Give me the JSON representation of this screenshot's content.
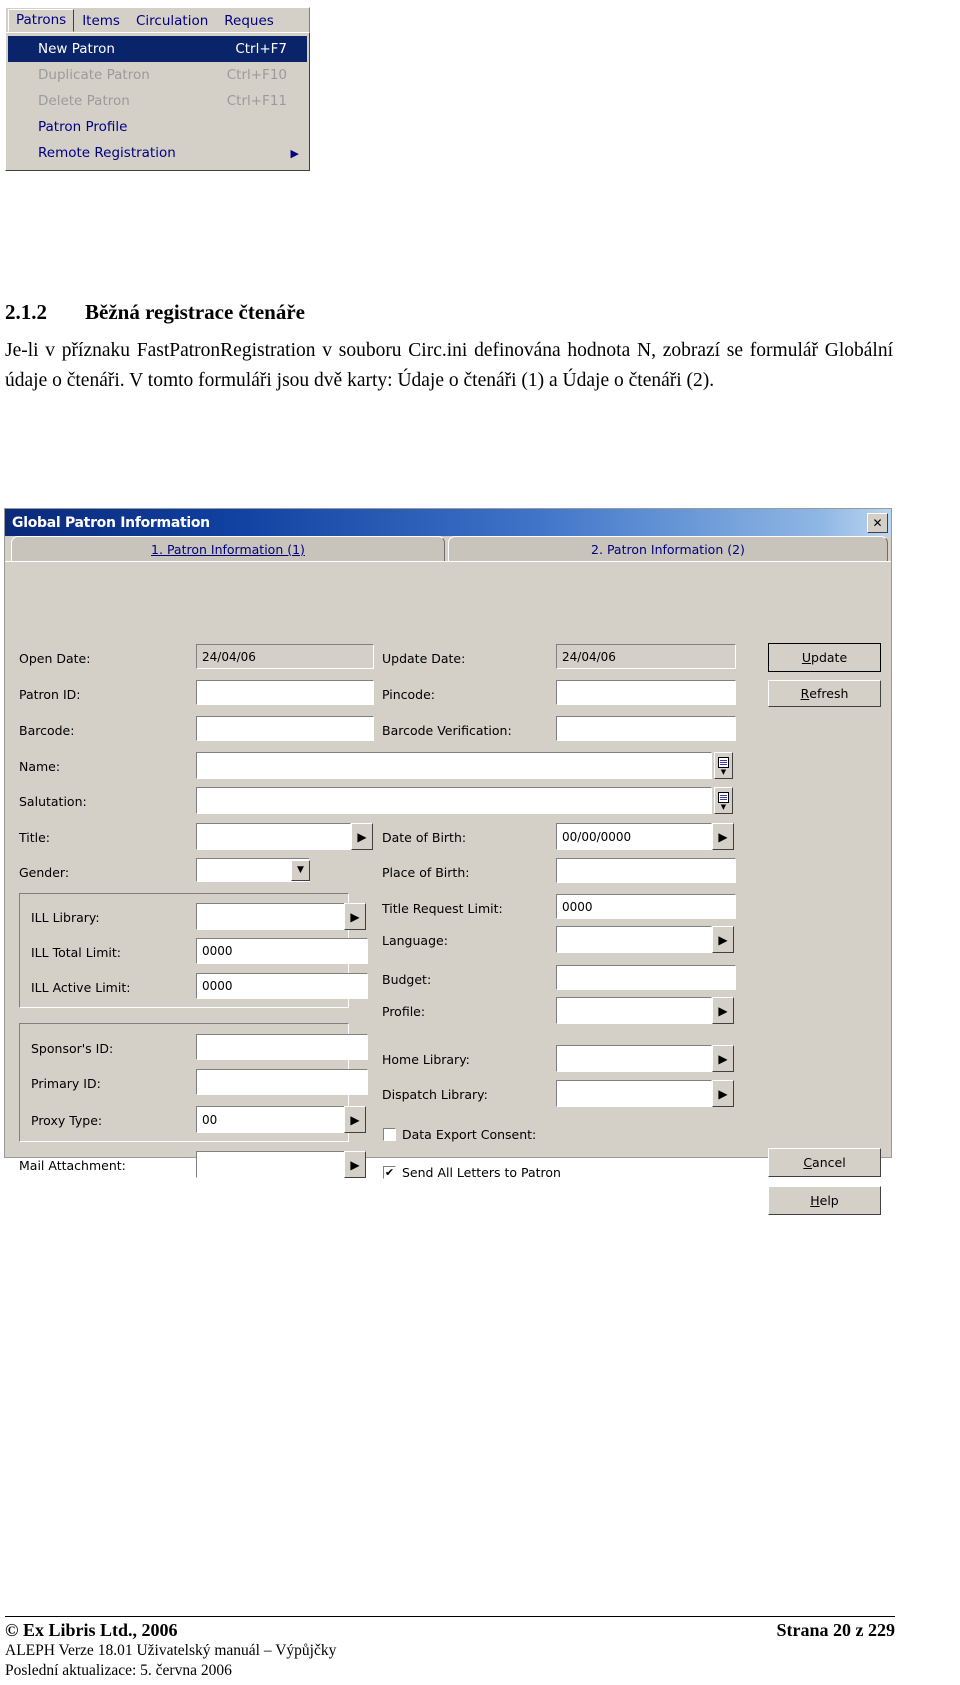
{
  "menu": {
    "menubar": [
      {
        "label": "Patrons",
        "open": true
      },
      {
        "label": "Items",
        "open": false
      },
      {
        "label": "Circulation",
        "open": false
      },
      {
        "label": "Reques",
        "open": false
      }
    ],
    "items": [
      {
        "label": "New Patron",
        "accel": "Ctrl+F7",
        "state": "highlight",
        "submenu": false
      },
      {
        "label": "Duplicate Patron",
        "accel": "Ctrl+F10",
        "state": "disabled",
        "submenu": false
      },
      {
        "label": "Delete Patron",
        "accel": "Ctrl+F11",
        "state": "disabled",
        "submenu": false
      },
      {
        "label": "Patron Profile",
        "accel": "",
        "state": "normal",
        "submenu": false
      },
      {
        "label": "Remote Registration",
        "accel": "",
        "state": "normal",
        "submenu": true
      }
    ]
  },
  "document": {
    "heading_number": "2.1.2",
    "heading_title": "Běžná registrace čtenáře",
    "paragraph": "Je-li v příznaku FastPatronRegistration v souboru Circ.ini definována hodnota N, zobrazí se formulář Globální údaje o čtenáři. V tomto formuláři jsou dvě karty: Údaje o čtenáři (1) a Údaje o čtenáři (2)."
  },
  "dialog": {
    "title": "Global Patron Information",
    "close_glyph": "✕",
    "tabs": [
      {
        "label": "1. Patron Information (1)",
        "active": true
      },
      {
        "label": "2. Patron Information (2)",
        "active": false
      }
    ],
    "fields": {
      "open_date": {
        "label": "Open Date:",
        "value": "24/04/06",
        "readonly": true
      },
      "update_date": {
        "label": "Update Date:",
        "value": "24/04/06",
        "readonly": true
      },
      "patron_id": {
        "label": "Patron ID:",
        "value": ""
      },
      "pincode": {
        "label": "Pincode:",
        "value": ""
      },
      "barcode": {
        "label": "Barcode:",
        "value": ""
      },
      "barcode_verification": {
        "label": "Barcode Verification:",
        "value": ""
      },
      "name": {
        "label": "Name:",
        "value": ""
      },
      "salutation": {
        "label": "Salutation:",
        "value": ""
      },
      "title": {
        "label": "Title:",
        "value": ""
      },
      "date_of_birth": {
        "label": "Date of Birth:",
        "value": "00/00/0000"
      },
      "gender": {
        "label": "Gender:",
        "value": ""
      },
      "place_of_birth": {
        "label": "Place of Birth:",
        "value": ""
      },
      "ill_library": {
        "label": "ILL Library:",
        "value": ""
      },
      "ill_total_limit": {
        "label": "ILL Total Limit:",
        "value": "0000"
      },
      "ill_active_limit": {
        "label": "ILL Active Limit:",
        "value": "0000"
      },
      "title_request_limit": {
        "label": "Title Request Limit:",
        "value": "0000"
      },
      "language": {
        "label": "Language:",
        "value": ""
      },
      "budget": {
        "label": "Budget:",
        "value": ""
      },
      "profile": {
        "label": "Profile:",
        "value": ""
      },
      "sponsors_id": {
        "label": "Sponsor's ID:",
        "value": ""
      },
      "primary_id": {
        "label": "Primary ID:",
        "value": ""
      },
      "proxy_type": {
        "label": "Proxy Type:",
        "value": "00"
      },
      "home_library": {
        "label": "Home Library:",
        "value": ""
      },
      "dispatch_library": {
        "label": "Dispatch Library:",
        "value": ""
      },
      "mail_attachment": {
        "label": "Mail Attachment:",
        "value": ""
      }
    },
    "checkboxes": [
      {
        "label": "Data Export Consent:",
        "checked": false,
        "mark": ""
      },
      {
        "label": "Send All Letters to Patron",
        "checked": true,
        "mark": "✔"
      }
    ],
    "buttons": {
      "update": {
        "label": "Update",
        "accel_char": "U",
        "rest": "pdate",
        "default": true
      },
      "refresh": {
        "label": "Refresh",
        "accel_char": "R",
        "rest": "efresh",
        "default": false
      },
      "cancel": {
        "label": "Cancel",
        "accel_char": "C",
        "rest": "ancel",
        "default": false
      },
      "help": {
        "label": "Help",
        "accel_char": "H",
        "rest": "elp",
        "default": false
      }
    }
  },
  "footer": {
    "copyright": "© Ex Libris Ltd., 2006",
    "page": "Strana 20 z 229",
    "line2": "ALEPH Verze 18.01 Uživatelský manuál – Výpůjčky",
    "line3": "Poslední aktualizace: 5. června 2006"
  }
}
